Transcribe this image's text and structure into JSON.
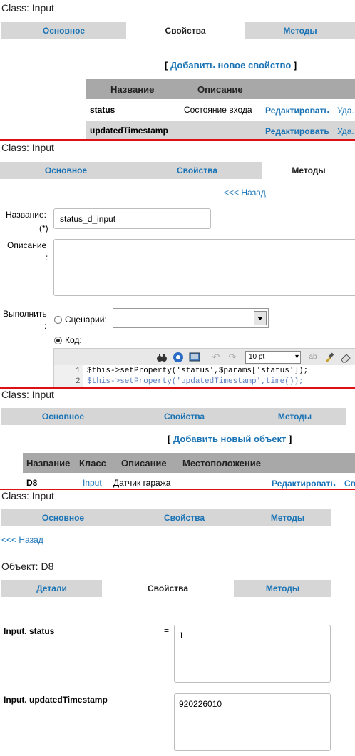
{
  "panel1": {
    "title": "Class: Input",
    "tabs": [
      "Основное",
      "Свойства",
      "Методы"
    ],
    "add_link": "Добавить новое свойство",
    "bracket_open": "[",
    "bracket_close": "]",
    "table": {
      "headers": [
        "Название",
        "Описание"
      ],
      "rows": [
        {
          "name": "status",
          "desc": "Состояние входа",
          "edit": "Редактировать",
          "del": "Уда."
        },
        {
          "name": "updatedTimestamp",
          "desc": "",
          "edit": "Редактировать",
          "del": "Уда."
        }
      ]
    }
  },
  "panel2": {
    "title": "Class: Input",
    "tabs": [
      "Основное",
      "Свойства",
      "Методы"
    ],
    "back_link": "<<< Назад",
    "name_label": "Название:",
    "required_mark": "(*)",
    "name_value": "status_d_input",
    "desc_label": "Описание",
    "desc_colon": ":",
    "exec_label": "Выполнить",
    "exec_colon": ":",
    "scenario_label": "Сценарий:",
    "code_label": "Код:",
    "font_size": "10 pt",
    "code_lines": [
      {
        "num": "1",
        "text": "$this->setProperty('status',$params['status']);"
      },
      {
        "num": "2",
        "text": "$this->setProperty('updatedTimestamp',time());"
      }
    ]
  },
  "panel3": {
    "title": "Class: Input",
    "tabs": [
      "Основное",
      "Свойства",
      "Методы"
    ],
    "add_link": "Добавить новый объект",
    "bracket_open": "[",
    "bracket_close": "]",
    "headers": [
      "Название",
      "Класс",
      "Описание",
      "Местоположение"
    ],
    "row": {
      "name": "D8",
      "class": "Input",
      "desc": "Датчик гаража",
      "edit": "Редактировать",
      "extra": "Св"
    }
  },
  "panel4": {
    "title": "Class: Input",
    "tabs": [
      "Основное",
      "Свойства",
      "Методы"
    ],
    "back_link": "<<< Назад",
    "object_title": "Объект: D8",
    "obj_tabs": [
      "Детали",
      "Свойства",
      "Методы"
    ],
    "props": [
      {
        "label": "Input. status",
        "eq": "=",
        "value": "1"
      },
      {
        "label": "Input. updatedTimestamp",
        "eq": "=",
        "value": "920226010"
      }
    ]
  },
  "colors": {
    "accent": "#1a73b5",
    "tab_bg": "#d6d6d6",
    "separator": "#dd1111"
  },
  "icons": [
    "binoculars-icon",
    "globe-icon",
    "monitor-icon",
    "undo-icon",
    "redo-icon",
    "spellcheck-icon",
    "brush-icon",
    "eraser-icon",
    "dropdown-arrow-icon"
  ]
}
